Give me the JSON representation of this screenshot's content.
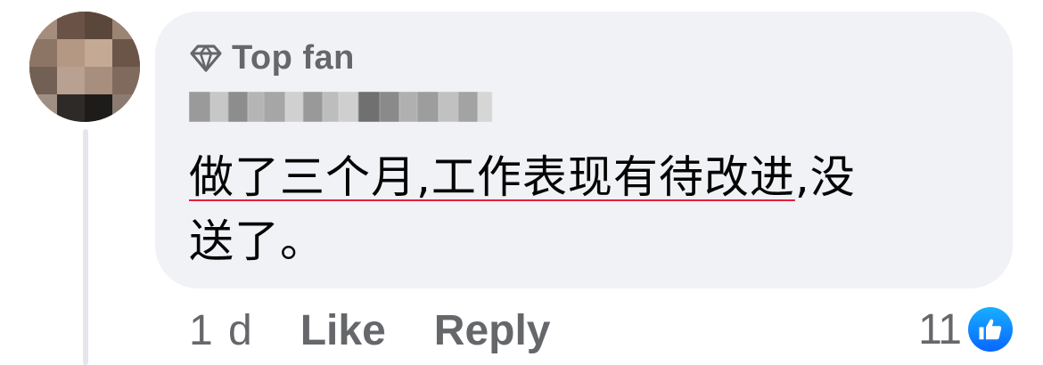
{
  "comment": {
    "badge_label": "Top fan",
    "author_name": "",
    "text_line1_underlined": "做了三个月,工作表现有待改进",
    "text_line1_rest": ",没",
    "text_line2": "送了。",
    "time": "1 d",
    "like_label": "Like",
    "reply_label": "Reply",
    "reaction_count": "11"
  },
  "icons": {
    "badge": "diamond-icon",
    "reaction": "thumbs-up-icon"
  },
  "colors": {
    "bubble": "#f0f2f5",
    "secondary_text": "#65676b",
    "primary_text": "#050505",
    "like_blue": "#0866ff",
    "spellcheck_red": "#e41e3f"
  }
}
